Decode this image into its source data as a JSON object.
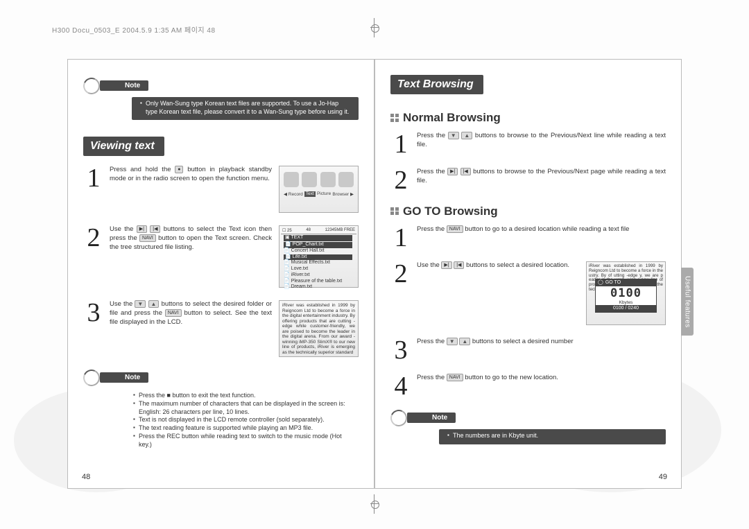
{
  "header": "H300 Docu_0503_E  2004.5.9 1:35 AM  페이지 48",
  "left": {
    "note1": {
      "title": "Note",
      "items": [
        "Only Wan-Sung type Korean text files are supported. To use a Jo-Hap type Korean text file, please convert it to a Wan-Sung type before using it."
      ]
    },
    "section": "Viewing text",
    "steps": {
      "s1_a": "Press and hold the ",
      "s1_btn": "●",
      "s1_b": " button in playback standby mode or in the radio screen to open the function menu.",
      "fm_labels": {
        "l0": "◀ Record",
        "l1": "Text",
        "l2": "Picture",
        "l3": "Browser ▶"
      },
      "s2_a": "Use the ",
      "s2_btn1": "▶|",
      "s2_btn2": "|◀",
      "s2_b": " buttons to select the Text icon then press the ",
      "s2_btn3": "NAVI",
      "s2_c": " button to open the Text screen. Check the tree structured file listing.",
      "file_header": {
        "a": "25",
        "b": "48",
        "c": "12345MB FREE"
      },
      "files": {
        "hdr": "TEXT",
        "f0": "POP_Chart.txt",
        "f1": "Concert Hall.txt",
        "f2": "Life.txt",
        "f3": "Musical Effects.txt",
        "f4": "Love.txt",
        "f5": "iRiver.txt",
        "f6": "Pleasure of the table.txt",
        "f7": "Dream.txt"
      },
      "s3_a": "Use the ",
      "s3_btn1": "▼",
      "s3_btn2": "▲",
      "s3_b": " buttons to select the desired folder or file and press the ",
      "s3_btn3": "NAVI",
      "s3_c": " button to select. See the text file displayed in the LCD.",
      "lcd_text": "iRiver was established in 1999 by Reigncom Ltd to become a force in the digital entertainment industry. By offering products that are cutting -edge while customer-friendly, we are poised to become the leader in the digital arena. From our award -winning iMP-350 SlimX® to our new line of products, iRiver is emerging as the technically superior standard"
    },
    "note2": {
      "title": "Note",
      "items": [
        "Press the ■ button to exit the text function.",
        "The maximum number of characters that can be displayed in the screen is: English: 26 characters per line, 10 lines.",
        "Text is not displayed in the LCD remote controller (sold separately).",
        "The text reading feature is supported while playing an MP3 file.",
        "Press the REC button while reading text to switch to the music mode (Hot key.)"
      ]
    },
    "page_num": "48"
  },
  "right": {
    "section": "Text Browsing",
    "sub1": "Normal Browsing",
    "normal": {
      "s1_a": "Press the ",
      "s1_b": " buttons to browse to the Previous/Next line while reading a text file.",
      "s2_a": "Press the ",
      "s2_b": " buttons to browse to the Previous/Next page while reading a text file."
    },
    "sub2": "GO TO Browsing",
    "goto": {
      "s1_a": "Press the ",
      "s1_btn": "NAVI",
      "s1_b": " button to go to a desired location while reading a text file",
      "s2_a": "Use the ",
      "s2_b": " buttons to select a desired location.",
      "popup": {
        "title": "GO TO",
        "big": "0100",
        "unit": "Kbytes",
        "ratio": "0100 / 0240"
      },
      "lcd_bg": "iRiver was established in 1999 by Reigncom Ltd to become a force in the                               ustry. By of                              utting -edge                              y, we are p                              eader in the                              ward -winn                              r new line of products, iRiver is emerging as the technically superior standard",
      "s3_a": "Press the ",
      "s3_b": " buttons to select a desired number",
      "s4_a": "Press the ",
      "s4_btn": "NAVI",
      "s4_b": " button to go to the new location."
    },
    "note": {
      "title": "Note",
      "items": [
        "The numbers are in Kbyte unit."
      ]
    },
    "side_tab": "Useful features",
    "page_num": "49"
  }
}
